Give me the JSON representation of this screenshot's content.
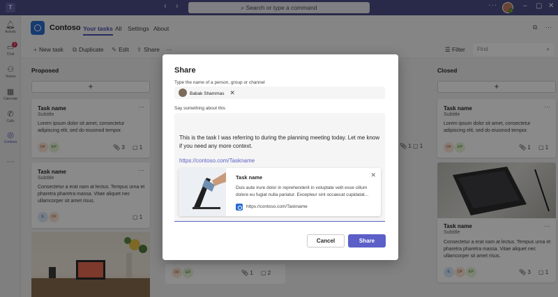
{
  "titlebar": {
    "logo": "T",
    "back_icon": "‹",
    "forward_icon": "›",
    "search_placeholder": "Search or type a command",
    "more": "···",
    "minimize": "–",
    "maximize": "▢",
    "close": "✕"
  },
  "rail": {
    "items": [
      {
        "label": "Activity",
        "icon": "bell-icon"
      },
      {
        "label": "Chat",
        "icon": "chat-icon",
        "badge": "1"
      },
      {
        "label": "Teams",
        "icon": "teams-icon"
      },
      {
        "label": "Calendar",
        "icon": "calendar-icon"
      },
      {
        "label": "Calls",
        "icon": "phone-icon"
      },
      {
        "label": "Contoso",
        "icon": "contoso-icon"
      }
    ],
    "more": "···"
  },
  "app": {
    "name": "Contoso",
    "tabs": [
      "Your tasks",
      "All",
      "Settings",
      "About"
    ]
  },
  "toolbar": {
    "new_task": "New task",
    "duplicate": "Duplicate",
    "edit": "Edit",
    "share": "Share",
    "more": "···",
    "filter": "Filter",
    "find_placeholder": "Find"
  },
  "board": {
    "columns": [
      {
        "title": "Proposed",
        "cards": [
          {
            "title": "Task name",
            "subtitle": "Subtitle",
            "body": "Lorem ipsum dolor sit amet, consectetur adipiscing elit, sed do eiusmod tempor.",
            "avatars": [
              "DF",
              "EP"
            ],
            "attachments": "3",
            "comments": "1"
          },
          {
            "title": "Task name",
            "subtitle": "Subtitle",
            "body": "Consectetur a erat nam at lectus. Tempus urna et pharetra pharetra massa. Vitae aliquet nec ullamcorper sit amet risus.",
            "avatars": [
              "IL",
              "DF"
            ],
            "comments": "1"
          }
        ]
      },
      {
        "title": "Closed",
        "cards": [
          {
            "title": "Task name",
            "subtitle": "Subtitle",
            "body": "Lorem ipsum dolor sit amet, consectetur adipiscing elit, sed do eiusmod tempor.",
            "avatars": [
              "DF",
              "EP"
            ],
            "attachments": "1",
            "comments": "1"
          },
          {
            "title": "Task name",
            "subtitle": "Subtitle",
            "body": "Consectetur a erat nam at lectus. Tempus urna et pharetra pharetra massa. Vitae aliquet nec ullamcorper sit amet risus.",
            "avatars": [
              "IL",
              "DF",
              "EP"
            ],
            "attachments": "3",
            "comments": "1"
          }
        ]
      }
    ],
    "middle_partial": {
      "avatars": [
        "DF",
        "EP"
      ],
      "attachments": "1",
      "comments": "2",
      "right_attachments": "1",
      "right_comments": "1"
    }
  },
  "dialog": {
    "title": "Share",
    "to_label": "Type the name of a person, group or channel",
    "recipient": "Babak Shammas",
    "message_label": "Say something about this",
    "message": "This is the task I was referring to during the planning meeting today. Let me know if you need any more context.",
    "link": "https://contoso.com/Taskname",
    "preview": {
      "title": "Task name",
      "description": "Duis aute irure dolor in reprehenderit in voluptate velit esse cillum dolore eu fugiat nulla pariatur. Excepteur sint occaecat cupidatat...",
      "url": "https://contoso.com/Taskname"
    },
    "cancel": "Cancel",
    "share": "Share"
  },
  "colors": {
    "titlebar": "#4c4e88",
    "brand": "#5b5fc7",
    "app_logo": "#2b6dd0"
  }
}
